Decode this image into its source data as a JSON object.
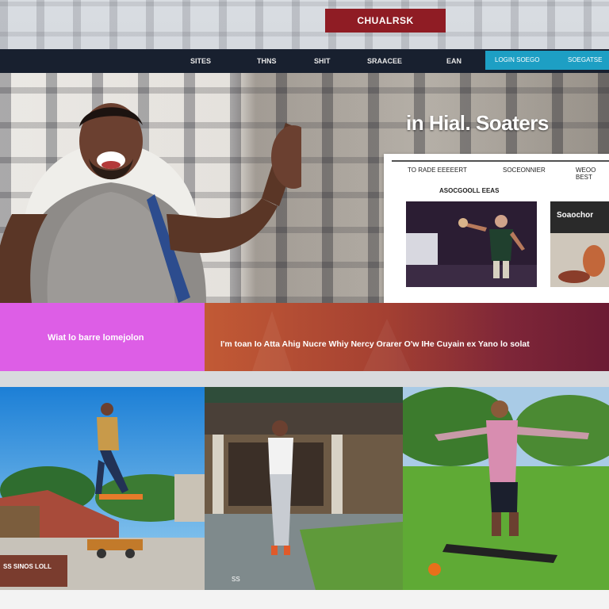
{
  "logo": {
    "text": "CHUALRSK"
  },
  "nav": {
    "items": [
      "SITES",
      "THNS",
      "SHIT",
      "SRAACEE",
      "EAN"
    ],
    "right_items": [
      "LOGIN SOEGO",
      "SOEGATSE"
    ]
  },
  "hero": {
    "title": "in Hial. Soaters"
  },
  "card": {
    "header_left": "TO RADE EEEEERT",
    "header_mid": "SOCEONNIER",
    "header_right": "WEOO BEST",
    "subtitle": "ASOCGOOLL EEAS",
    "thumb2_label": "Soaochor"
  },
  "band": {
    "left_text": "Wiat lo barre lomejolon",
    "right_text": "I'm toan Io Atta Ahig Nucre Whiy  Nercy Orarer O'w IHe Cuyain ex Yano lo solat"
  },
  "photos": {
    "caption_left": "SS SINOS LOLL",
    "caption_mid": "SS"
  },
  "colors": {
    "logo_bg": "#8f1c24",
    "nav_bg": "#18202f",
    "nav_accent": "#1d9fc4",
    "band_pink": "#dd5ee6",
    "band_rust": "#a44032"
  }
}
